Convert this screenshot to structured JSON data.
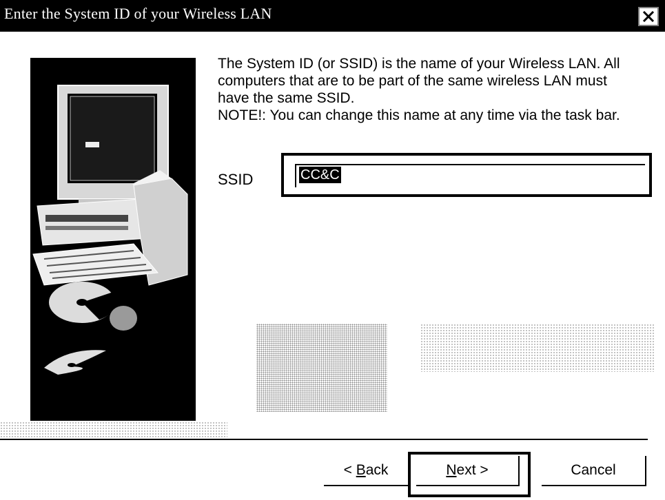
{
  "window": {
    "title": "Enter the System ID of your Wireless LAN",
    "close_icon": "close-icon"
  },
  "description": {
    "line1": "The System ID (or SSID) is the name of your Wireless LAN.  All",
    "line2": "computers that are to be part of the same wireless LAN must",
    "line3": "have the same SSID.",
    "line4": "NOTE!: You can change this name at any time via the task bar."
  },
  "ssid": {
    "label": "SSID",
    "value": "CC&C"
  },
  "buttons": {
    "back_prefix": "< ",
    "back_accel": "B",
    "back_rest": "ack",
    "next_accel": "N",
    "next_rest": "ext >",
    "cancel": "Cancel"
  },
  "illustration": {
    "icon": "computer-illustration"
  }
}
